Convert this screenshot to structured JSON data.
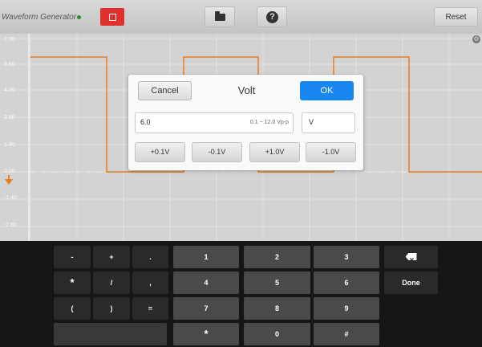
{
  "toolbar": {
    "app_title": "Waveform Generator",
    "reset_label": "Reset"
  },
  "plot": {
    "y_labels": [
      "7.00",
      "5.60",
      "4.20",
      "2.80",
      "1.40",
      "0.00",
      "-1.40",
      "-2.80"
    ]
  },
  "dialog": {
    "cancel_label": "Cancel",
    "title": "Volt",
    "ok_label": "OK",
    "value": "6.0",
    "range_hint": "0.1 ~ 12.0 Vp-p",
    "unit": "V",
    "step_buttons": [
      "+0.1V",
      "-0.1V",
      "+1.0V",
      "-1.0V"
    ]
  },
  "keyboard": {
    "sym_row1": [
      "-",
      "+",
      "."
    ],
    "sym_row2": [
      "*",
      "/",
      ","
    ],
    "sym_row3": [
      "(",
      ")",
      "="
    ],
    "num_row1": [
      "1",
      "2",
      "3"
    ],
    "num_row2": [
      "4",
      "5",
      "6"
    ],
    "num_row3": [
      "7",
      "8",
      "9"
    ],
    "num_row4": [
      "*",
      "0",
      "#"
    ],
    "done_label": "Done"
  },
  "colors": {
    "waveform": "#e67e22",
    "ok_button": "#1a86f0",
    "stop_button": "#e0312e"
  }
}
